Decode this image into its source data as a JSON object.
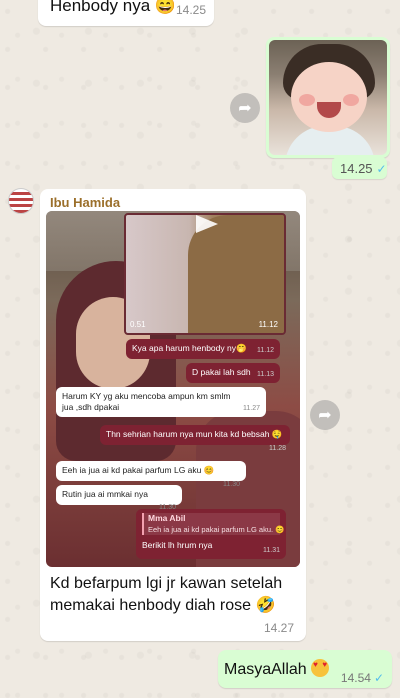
{
  "messages": {
    "top_partial": {
      "text": "Henbody nya 😄",
      "time": "14.25"
    },
    "photo": {
      "time": "14.25",
      "tick": "✓"
    },
    "incoming": {
      "sender": "Ibu Hamida",
      "screenshot": {
        "video_time": "0.51",
        "video_ts": "11.12",
        "chips": [
          {
            "text": "Kya apa harum henbody ny🤭",
            "time": "11.12"
          },
          {
            "text": "D pakai lah sdh",
            "time": "11.13"
          },
          {
            "text": "Harum KY yg aku mencoba ampun km smlm",
            "text2": "jua ,sdh dpakai",
            "time": "11.27"
          },
          {
            "text": "Thn sehrian harum nya mun kita kd bebsah 🤤",
            "time": "11.28"
          },
          {
            "text": "Eeh ia jua ai kd pakai parfum LG aku 😊",
            "time": "11.30"
          },
          {
            "text": "Rutin jua ai mmkai nya",
            "time": "11.30"
          },
          {
            "text": "Mma Abil",
            "text2": "Eeh ia jua ai kd pakai parfum LG aku. 😊",
            "text3": "Berikit lh hrum nya",
            "time": "11.31"
          }
        ]
      },
      "text": "Kd befarpum lgi jr kawan setelah memakai henbody diah rose 🤣",
      "time": "14.27"
    },
    "outgoing_bottom": {
      "text": "MasyaAllah",
      "time": "14.54",
      "tick": "✓"
    }
  },
  "icons": {
    "forward": "forward-icon",
    "play": "play-icon"
  }
}
